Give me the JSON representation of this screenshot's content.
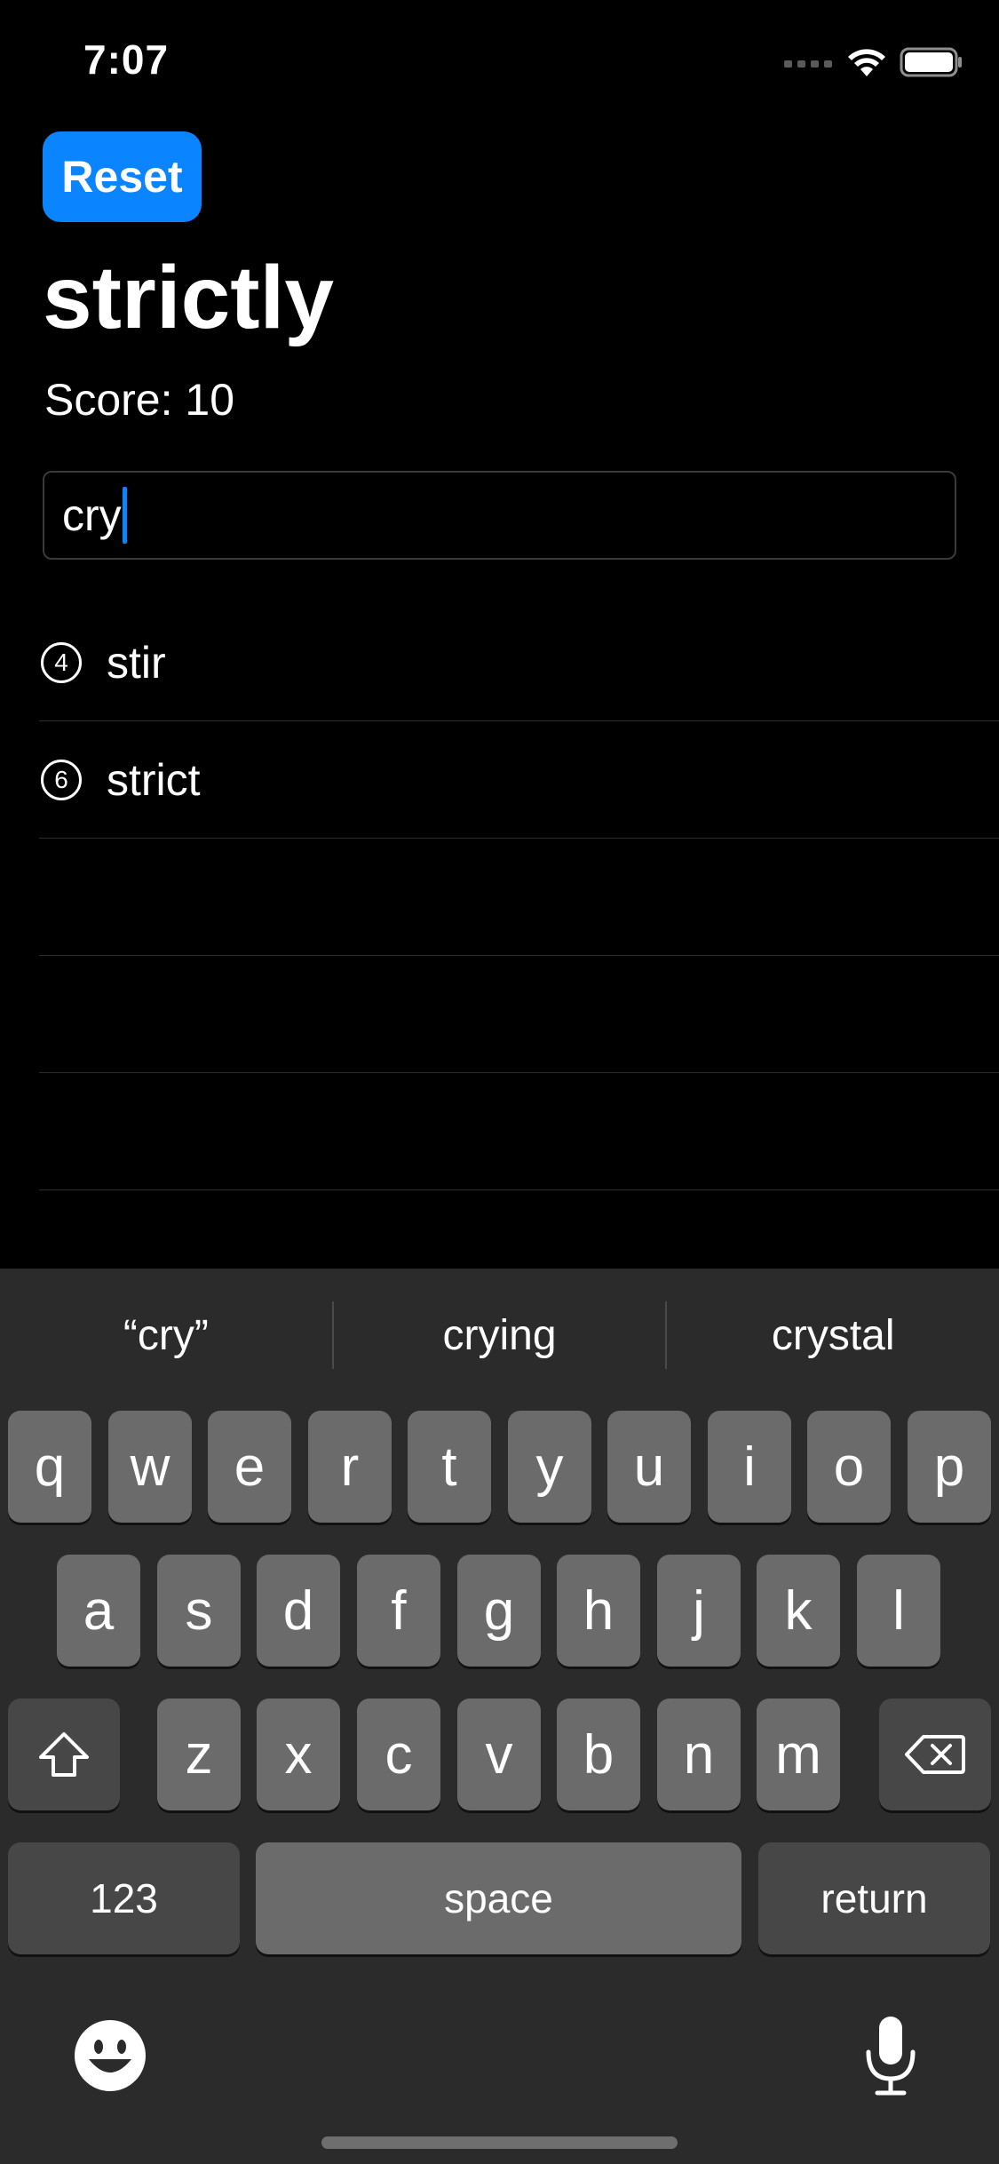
{
  "status_bar": {
    "time": "7:07",
    "icons": [
      "signal-icon",
      "wifi-icon",
      "battery-icon"
    ]
  },
  "header": {
    "reset_label": "Reset",
    "title": "strictly",
    "score_text": "Score: 10"
  },
  "input": {
    "value": "cry"
  },
  "words": [
    {
      "count": "4",
      "word": "stir"
    },
    {
      "count": "6",
      "word": "strict"
    }
  ],
  "keyboard": {
    "suggestions": [
      "“cry”",
      "crying",
      "crystal"
    ],
    "row1": [
      "q",
      "w",
      "e",
      "r",
      "t",
      "y",
      "u",
      "i",
      "o",
      "p"
    ],
    "row2": [
      "a",
      "s",
      "d",
      "f",
      "g",
      "h",
      "j",
      "k",
      "l"
    ],
    "row3": [
      "z",
      "x",
      "c",
      "v",
      "b",
      "n",
      "m"
    ],
    "numbers_label": "123",
    "space_label": "space",
    "return_label": "return"
  },
  "colors": {
    "accent": "#0a84ff",
    "background": "#000000",
    "keyboard_bg": "#2b2b2b",
    "key": "#6b6b6b",
    "key_dark": "#474747"
  }
}
